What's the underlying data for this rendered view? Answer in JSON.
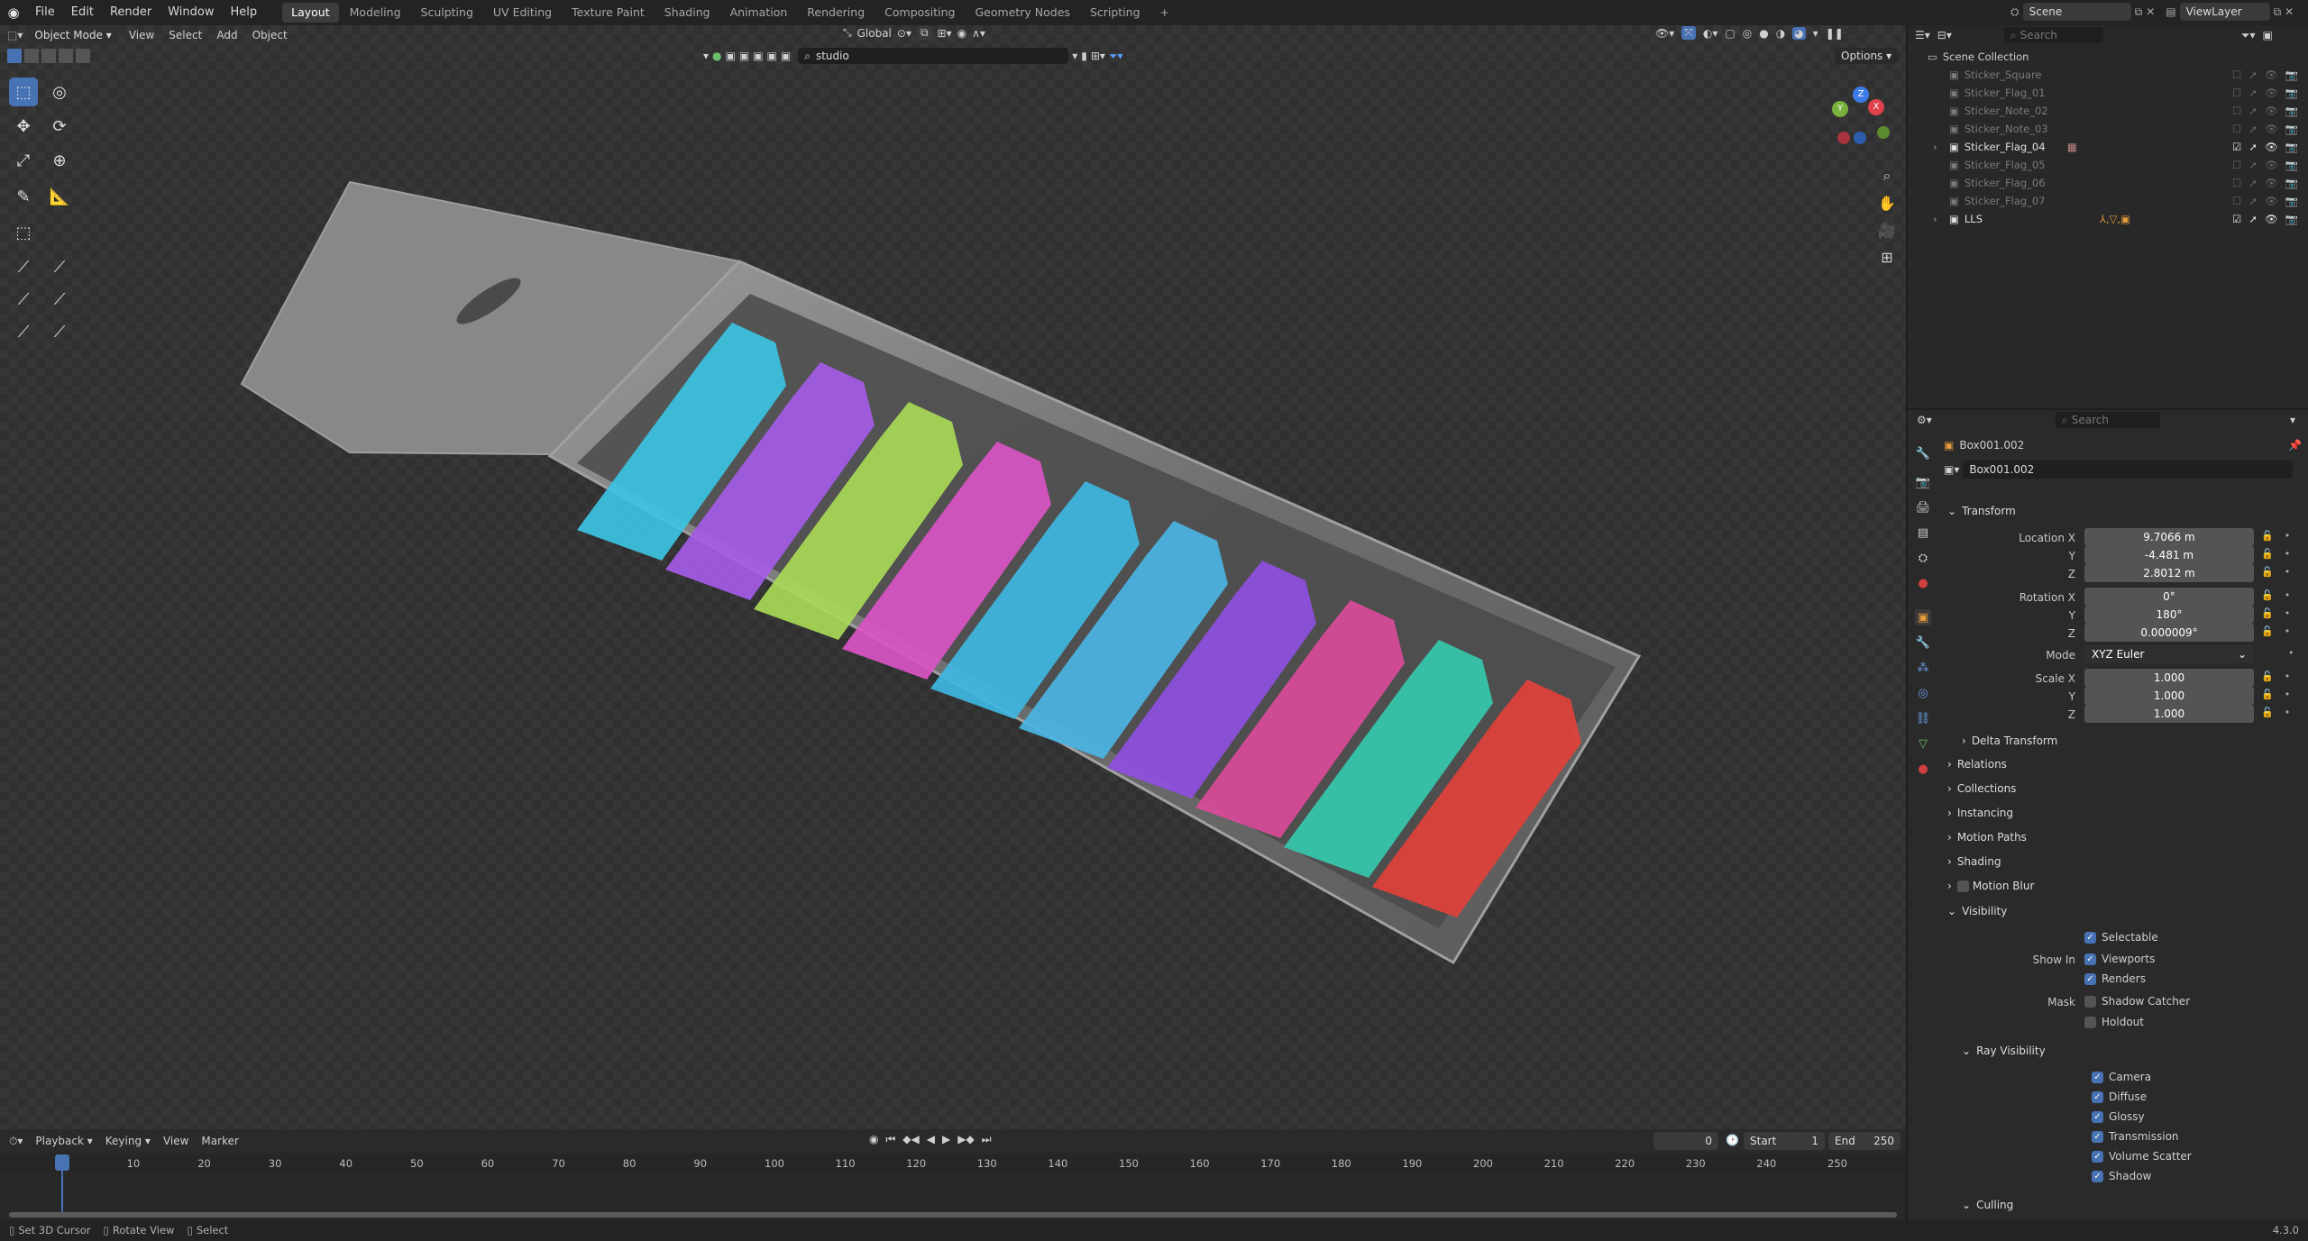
{
  "topbar": {
    "menus": [
      "File",
      "Edit",
      "Render",
      "Window",
      "Help"
    ],
    "workspaces": [
      "Layout",
      "Modeling",
      "Sculpting",
      "UV Editing",
      "Texture Paint",
      "Shading",
      "Animation",
      "Rendering",
      "Compositing",
      "Geometry Nodes",
      "Scripting",
      "+"
    ],
    "scene": "Scene",
    "view_layer": "ViewLayer"
  },
  "viewport_header": {
    "mode": "Object Mode",
    "menus": [
      "View",
      "Select",
      "Add",
      "Object"
    ],
    "orientation": "Global",
    "search_value": "studio",
    "options": "Options"
  },
  "outliner": {
    "search_placeholder": "Search",
    "collection": "Scene Collection",
    "items": [
      "Sticker_Square",
      "Sticker_Flag_01",
      "Sticker_Note_02",
      "Sticker_Note_03",
      "Sticker_Flag_04",
      "Sticker_Flag_05",
      "Sticker_Flag_06",
      "Sticker_Flag_07",
      "LLS"
    ]
  },
  "properties": {
    "search_placeholder": "Search",
    "object_name": "Box001.002",
    "datablock": "Box001.002",
    "transform_label": "Transform",
    "location_label": "Location X",
    "location": [
      "9.7066 m",
      "-4.481 m",
      "2.8012 m"
    ],
    "rotation_label": "Rotation X",
    "rotation": [
      "0°",
      "180°",
      "0.000009°"
    ],
    "mode_label": "Mode",
    "mode": "XYZ Euler",
    "scale_label": "Scale X",
    "scale": [
      "1.000",
      "1.000",
      "1.000"
    ],
    "axis_y": "Y",
    "axis_z": "Z",
    "delta": "Delta Transform",
    "panels": [
      "Relations",
      "Collections",
      "Instancing",
      "Motion Paths",
      "Shading",
      "Motion Blur"
    ],
    "visibility": "Visibility",
    "selectable": "Selectable",
    "show_in": "Show In",
    "viewports": "Viewports",
    "renders": "Renders",
    "mask": "Mask",
    "shadow_catcher": "Shadow Catcher",
    "holdout": "Holdout",
    "ray_visibility": "Ray Visibility",
    "rays": [
      "Camera",
      "Diffuse",
      "Glossy",
      "Transmission",
      "Volume Scatter",
      "Shadow"
    ],
    "culling": "Culling"
  },
  "timeline": {
    "menus": [
      "Playback",
      "Keying",
      "View",
      "Marker"
    ],
    "current_frame": "0",
    "start_label": "Start",
    "start": "1",
    "end_label": "End",
    "end": "250",
    "ticks": [
      "0",
      "10",
      "20",
      "30",
      "40",
      "50",
      "60",
      "70",
      "80",
      "90",
      "100",
      "110",
      "120",
      "130",
      "140",
      "150",
      "160",
      "170",
      "180",
      "190",
      "200",
      "210",
      "220",
      "230",
      "240",
      "250"
    ]
  },
  "statusbar": {
    "items": [
      "Set 3D Cursor",
      "Rotate View",
      "Select"
    ],
    "version": "4.3.0"
  },
  "colors": {
    "accent": "#4772b3",
    "stickers": [
      "#3cc3e2",
      "#a45ce8",
      "#a9d957",
      "#d954c4",
      "#3fb7e1",
      "#4ab4e3",
      "#8e4fe0",
      "#d94a98",
      "#35c9ae",
      "#e0413a"
    ]
  }
}
